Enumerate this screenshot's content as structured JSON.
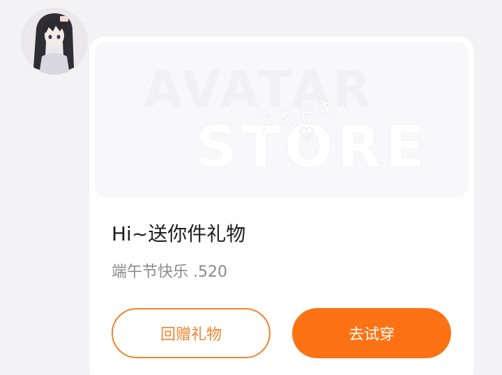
{
  "colors": {
    "accent": "#fd7214",
    "accent_outline": "#f0832b",
    "page_background": "#f3f3f5",
    "card_background": "#ffffff"
  },
  "sender": {
    "avatar_icon": "anime-girl-avatar"
  },
  "gift_card": {
    "banner": {
      "line1": "AVATAR",
      "line2": "STORE",
      "decoration_text": "ドキドキ",
      "decoration_icon": "heart-outline-icon"
    },
    "title": "Hi~送你件礼物",
    "subtitle": "端午节快乐 .520",
    "buttons": {
      "return_gift": "回赠礼物",
      "try_on": "去试穿"
    }
  }
}
